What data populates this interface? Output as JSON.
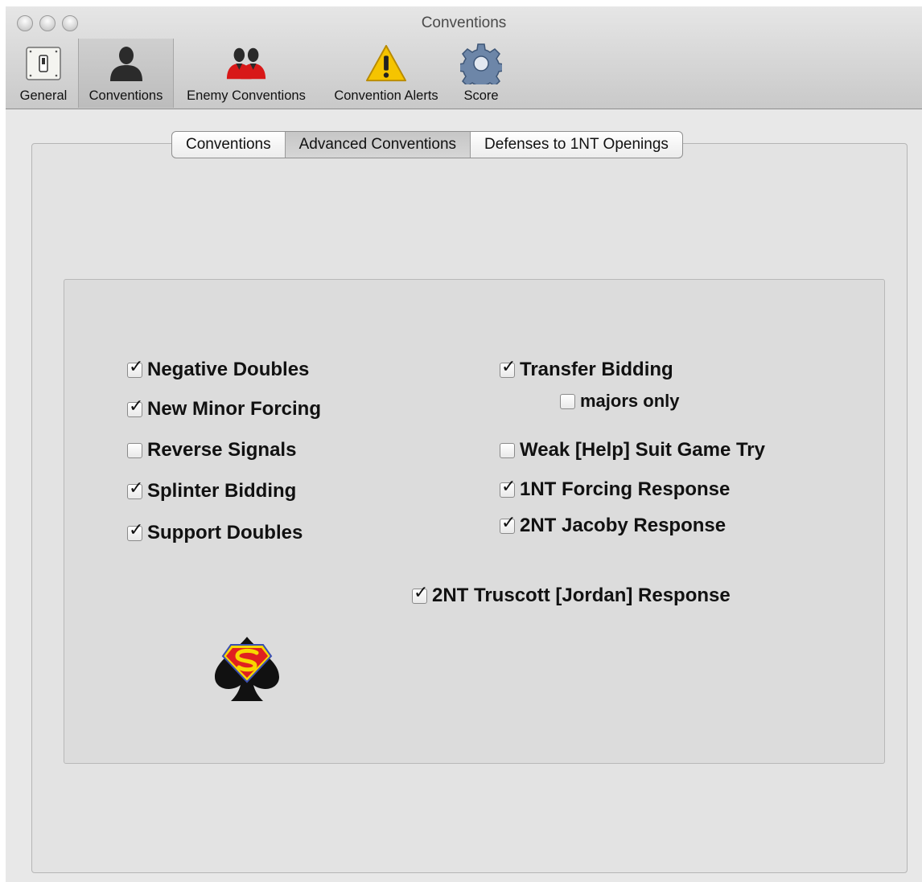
{
  "window": {
    "title": "Conventions"
  },
  "toolbar": {
    "items": [
      {
        "label": "General",
        "icon": "switch-icon"
      },
      {
        "label": "Conventions",
        "icon": "person-icon",
        "selected": true
      },
      {
        "label": "Enemy Conventions",
        "icon": "enemy-people-icon"
      },
      {
        "label": "Convention Alerts",
        "icon": "warning-icon"
      },
      {
        "label": "Score",
        "icon": "gear-icon"
      }
    ]
  },
  "tabs": {
    "items": [
      {
        "label": "Conventions"
      },
      {
        "label": "Advanced Conventions",
        "selected": true
      },
      {
        "label": "Defenses to 1NT Openings"
      }
    ]
  },
  "options": {
    "negative_doubles": {
      "label": "Negative Doubles",
      "checked": true
    },
    "new_minor_forcing": {
      "label": "New Minor Forcing",
      "checked": true
    },
    "reverse_signals": {
      "label": "Reverse Signals",
      "checked": false
    },
    "splinter_bidding": {
      "label": "Splinter Bidding",
      "checked": true
    },
    "support_doubles": {
      "label": "Support Doubles",
      "checked": true
    },
    "transfer_bidding": {
      "label": "Transfer Bidding",
      "checked": true
    },
    "majors_only": {
      "label": "majors only",
      "checked": false
    },
    "weak_help_suit": {
      "label": "Weak [Help] Suit Game Try",
      "checked": false
    },
    "nt_forcing": {
      "label": "1NT Forcing Response",
      "checked": true
    },
    "nt_jacoby": {
      "label": "2NT Jacoby Response",
      "checked": true
    },
    "nt_truscott": {
      "label": "2NT Truscott [Jordan] Response",
      "checked": true
    }
  },
  "checkmark_glyph": "✓",
  "colors": {
    "warning": "#f5c400",
    "enemy": "#d81818",
    "logo_red": "#e02020",
    "logo_yellow": "#f7d800"
  }
}
